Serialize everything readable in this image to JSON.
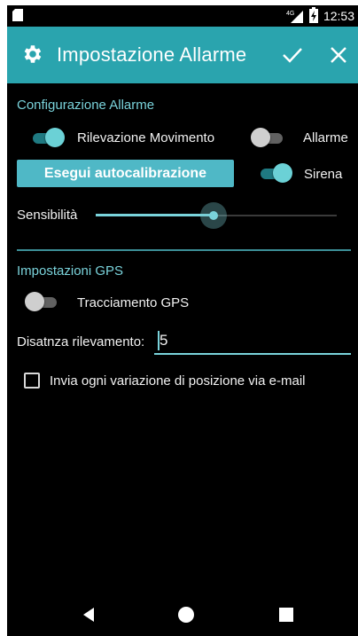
{
  "statusbar": {
    "network": "4G",
    "time": "12:53"
  },
  "appbar": {
    "title": "Impostazione Allarme",
    "color": "#2aa4ae"
  },
  "alarm_config": {
    "section_title": "Configurazione Allarme",
    "motion_detection": {
      "label": "Rilevazione Movimento",
      "on": true
    },
    "alarm": {
      "label": "Allarme",
      "on": false
    },
    "calibrate_button": "Esegui autocalibrazione",
    "siren": {
      "label": "Sirena",
      "on": true
    },
    "sensitivity": {
      "label": "Sensibilità",
      "value_fraction": 0.49
    }
  },
  "gps": {
    "section_title": "Impostazioni GPS",
    "tracking": {
      "label": "Tracciamento GPS",
      "on": false
    },
    "distance": {
      "label": "Disatnza rilevamento:",
      "value": "5"
    },
    "email_option": {
      "label": "Invia ogni variazione di posizione via e-mail",
      "checked": false
    }
  },
  "colors": {
    "accent": "#7ad3db",
    "background": "#000000"
  }
}
